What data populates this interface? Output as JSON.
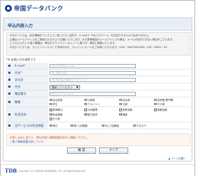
{
  "brand": {
    "logo_text": "帝国データバンク",
    "footer_logo": "TDB",
    "copyright": "Copyright (C) TEIKOKU DATABANK, LTD. All Rights Reserved."
  },
  "page": {
    "title": "申込内容入力"
  },
  "notice": {
    "lines": [
      "※当サービスは、会社情報をウェブ上でご覧いただく目的で、E-mailで「ID/パスワード」をお送りするものではありません。",
      "正確なメールアドレスをご登録されますようお願いいたします。また携帯電話のメールアドレスの場合、メールが送付できない場合がございます。",
      "ご入力いただいた個人情報は、弊社のプライバシーポリシーに基づき、適切に管理いたします。",
      "※当サービスでは、コンビニエンスストア決済のほか、クレジットカードをご利用いただけます。VISA・MASTERCARD・JCB・AMEX・DC"
    ]
  },
  "required_note": "※ 必須入力の項目です",
  "form": {
    "email": {
      "label": "E-mail",
      "required": "*",
      "placeholder": "例) info@tdb.co.jp"
    },
    "name": {
      "label": "氏名",
      "required": "*",
      "placeholder": "例) 帝国 太郎"
    },
    "company": {
      "label": "会社名",
      "placeholder": "例) 株式会社帝国データバンク"
    },
    "address": {
      "label": "住所",
      "select_value": "選択してください"
    },
    "phone": {
      "label": "電話番号",
      "placeholder": "例) 03-5775-3000"
    },
    "occupation": {
      "label": "職業",
      "options": [
        "会社経営",
        "公務員",
        "会社員",
        "自営業/専門職",
        "学生",
        "アルバイト",
        "主婦",
        "その他"
      ]
    },
    "purpose": {
      "label": "利用目的",
      "options": [
        "新規取引",
        "与信管理",
        "営業活動",
        "就職活動",
        "商品調査",
        "株式投資",
        "調査",
        "その他"
      ]
    },
    "mail_delivery": {
      "label": "当サービスの利用頻度",
      "options": [
        "毎日",
        "週に1回程度",
        "月に1回程度",
        "それ以下"
      ]
    }
  },
  "caution": {
    "line1": "お申し込みにあたり、弊社の個人情報保護方針をご確認ください。",
    "line2": "» 個人情報保護方針について"
  },
  "buttons": {
    "confirm": "確 認",
    "clear": "クリア"
  },
  "pagetop": "▲ ページ先頭へ"
}
